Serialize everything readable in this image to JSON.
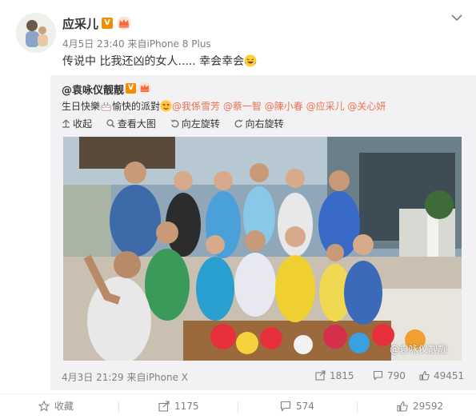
{
  "post": {
    "username": "应采儿",
    "meta": "4月5日 23:40 来自iPhone 8 Plus",
    "text": "传说中 比我还凶的女人..... 幸会幸会"
  },
  "repost": {
    "username": "@袁咏仪靓靓",
    "text_prefix": "生日快樂",
    "text_mid": "愉快的派對",
    "mentions": [
      "@我係雪芳",
      "@蔡一智",
      "@陳小春",
      "@应采儿",
      "@关心妍"
    ],
    "tools": [
      {
        "label": "收起",
        "icon": "collapse-icon"
      },
      {
        "label": "查看大图",
        "icon": "zoom-icon"
      },
      {
        "label": "向左旋转",
        "icon": "rotate-left-icon"
      },
      {
        "label": "向右旋转",
        "icon": "rotate-right-icon"
      }
    ],
    "watermark": "@袁咏仪靓靓",
    "time": "4月3日 21:29 来自iPhone X",
    "stats": {
      "repost": "1815",
      "comment": "790",
      "like": "49451"
    }
  },
  "actions": {
    "favorite": "收藏",
    "repost": "1175",
    "comment": "574",
    "like": "29592"
  },
  "colors": {
    "mention": "#eb7350",
    "verified": "#f28c00",
    "repost_bg": "#f2f2f5"
  }
}
